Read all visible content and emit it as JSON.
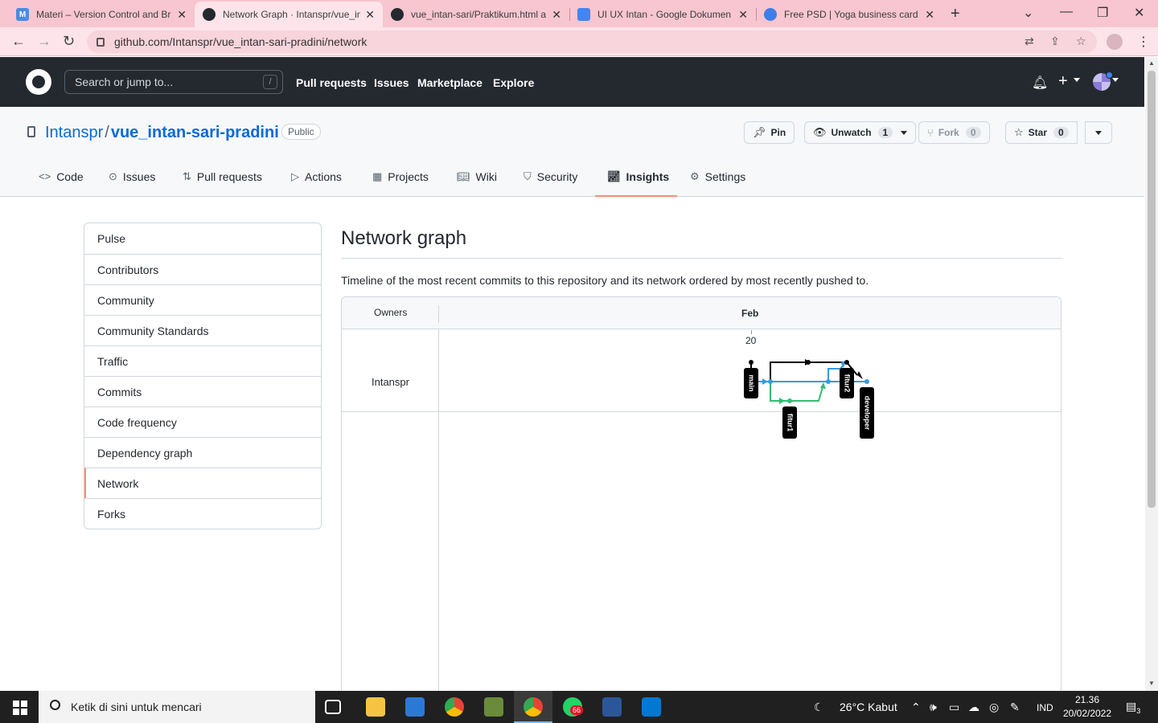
{
  "browser": {
    "tabs": [
      {
        "title": "Materi – Version Control and Br",
        "favicon": "M"
      },
      {
        "title": "Network Graph · Intanspr/vue_in",
        "favicon": "github"
      },
      {
        "title": "vue_intan-sari/Praktikum.html a",
        "favicon": "github"
      },
      {
        "title": "UI UX Intan - Google Dokumen",
        "favicon": "docs"
      },
      {
        "title": "Free PSD | Yoga business card te",
        "favicon": "freepik"
      }
    ],
    "url": "github.com/Intanspr/vue_intan-sari-pradini/network"
  },
  "gh_header": {
    "search_placeholder": "Search or jump to...",
    "search_shortcut": "/",
    "nav": [
      "Pull requests",
      "Issues",
      "Marketplace",
      "Explore"
    ]
  },
  "repo": {
    "owner": "Intanspr",
    "separator": "/",
    "name": "vue_intan-sari-pradini",
    "visibility": "Public",
    "pin_label": "Pin",
    "watch_label": "Unwatch",
    "watch_count": "1",
    "fork_label": "Fork",
    "fork_count": "0",
    "star_label": "Star",
    "star_count": "0"
  },
  "repo_tabs": [
    "Code",
    "Issues",
    "Pull requests",
    "Actions",
    "Projects",
    "Wiki",
    "Security",
    "Insights",
    "Settings"
  ],
  "sidebar": {
    "items": [
      "Pulse",
      "Contributors",
      "Community",
      "Community Standards",
      "Traffic",
      "Commits",
      "Code frequency",
      "Dependency graph",
      "Network",
      "Forks"
    ],
    "selected": "Network"
  },
  "main": {
    "title": "Network graph",
    "description": "Timeline of the most recent commits to this repository and its network ordered by most recently pushed to."
  },
  "network": {
    "owners_label": "Owners",
    "month": "Feb",
    "day": "20",
    "owner": "Intanspr",
    "branches": [
      "main",
      "fitur1",
      "fitur2",
      "developer"
    ],
    "colors": {
      "main": "#000000",
      "developer": "#3a9ad9",
      "fitur1": "#2fbf71",
      "accent": "#fd8c73"
    }
  },
  "taskbar": {
    "search_placeholder": "Ketik di sini untuk mencari",
    "weather": "26°C  Kabut",
    "lang": "IND",
    "time": "21.36",
    "date": "20/02/2022",
    "whatsapp_badge": "66",
    "notif_count": "3"
  }
}
